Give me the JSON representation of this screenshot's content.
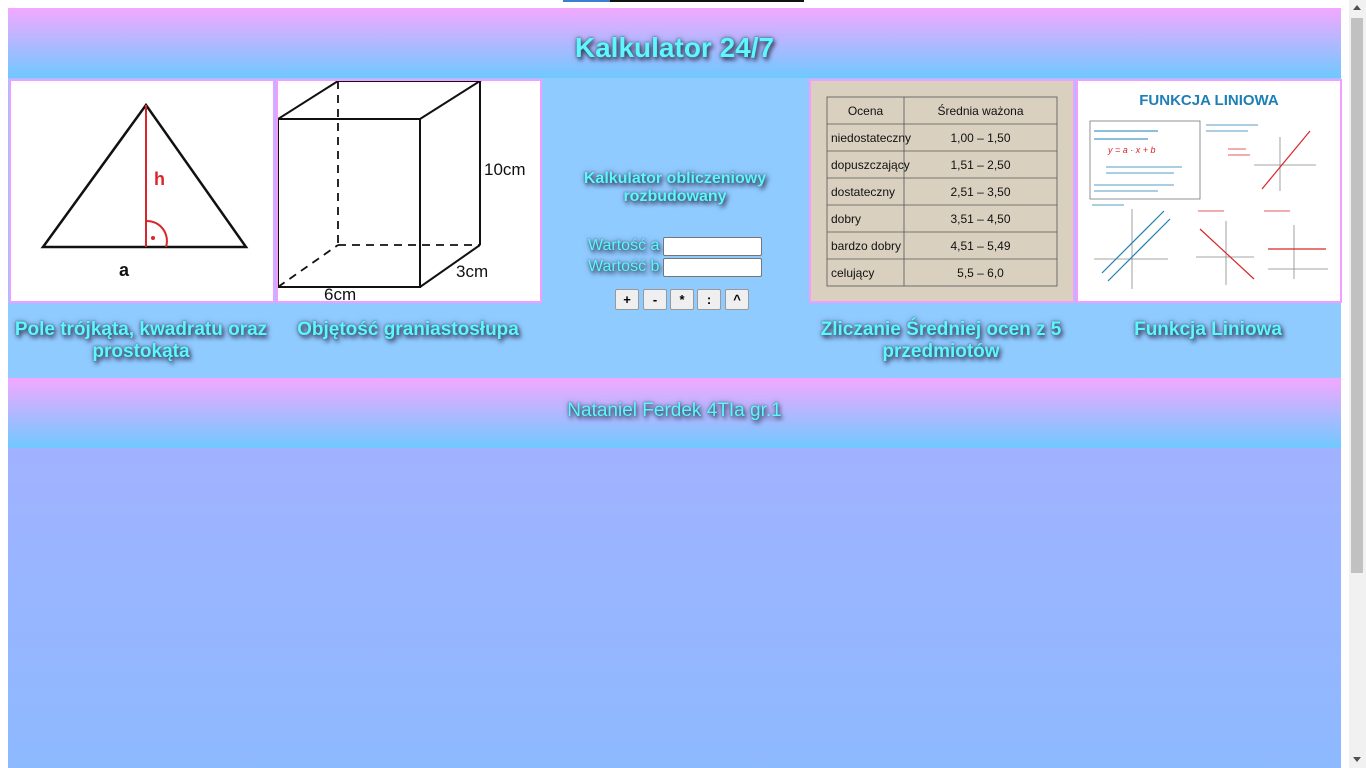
{
  "header": {
    "title": "Kalkulator 24/7"
  },
  "tiles": [
    {
      "caption": "Pole trójkąta, kwadratu oraz prostokąta",
      "labels": {
        "height": "h",
        "base": "a"
      }
    },
    {
      "caption": "Objętość graniastosłupa",
      "labels": {
        "height": "10cm",
        "depth": "3cm",
        "width": "6cm"
      }
    },
    {
      "caption": "Zliczanie Średniej ocen z 5 przedmiotów",
      "table": {
        "headers": [
          "Ocena",
          "Średnia ważona"
        ],
        "rows": [
          [
            "niedostateczny",
            "1,00 – 1,50"
          ],
          [
            "dopuszczający",
            "1,51 – 2,50"
          ],
          [
            "dostateczny",
            "2,51 – 3,50"
          ],
          [
            "dobry",
            "3,51 – 4,50"
          ],
          [
            "bardzo dobry",
            "4,51 – 5,49"
          ],
          [
            "celujący",
            "5,5 – 6,0"
          ]
        ]
      }
    },
    {
      "caption": "Funkcja Liniowa",
      "image_title": "FUNKCJA LINIOWA",
      "image_formula": "y = a · x + b"
    }
  ],
  "calculator": {
    "title": "Kalkulator obliczeniowy rozbudowany",
    "field_a": {
      "label": "Wartość a",
      "value": ""
    },
    "field_b": {
      "label": "Wartość b",
      "value": ""
    },
    "ops": [
      "+",
      "-",
      "*",
      ":",
      "^"
    ]
  },
  "footer": {
    "author": "Nataniel Ferdek 4TIa gr.1"
  },
  "colors": {
    "header_gradient_top": "#f3a8ff",
    "header_gradient_bottom": "#6fc8ff",
    "content_bg": "#8fcbff",
    "text_glow": "#5ff6ff",
    "image_border": "#f29dff"
  }
}
